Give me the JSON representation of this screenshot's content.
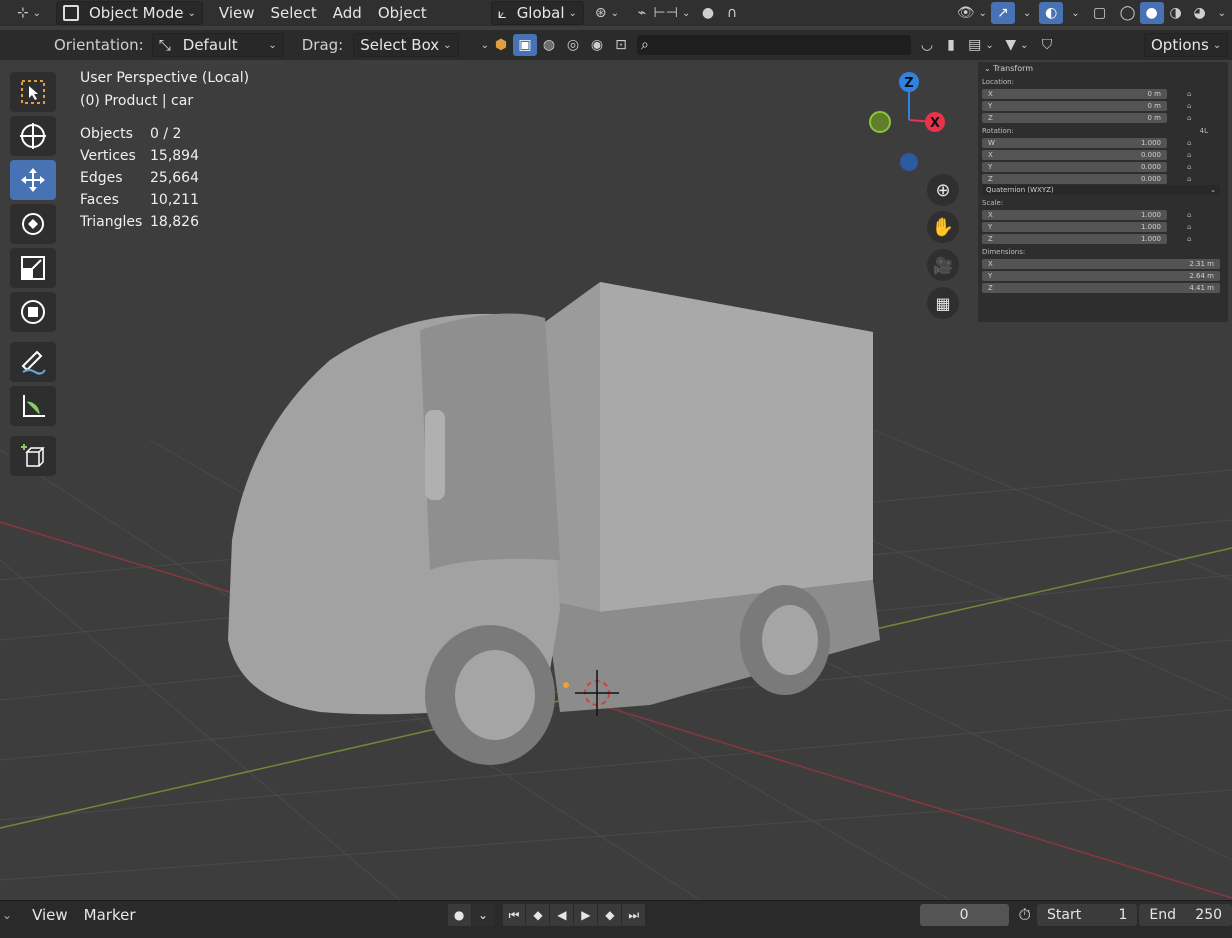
{
  "header": {
    "mode": "Object Mode",
    "menus": [
      "View",
      "Select",
      "Add",
      "Object"
    ],
    "transform_orientation": "Global"
  },
  "tool_header": {
    "orientation_label": "Orientation:",
    "orientation_value": "Default",
    "drag_label": "Drag:",
    "drag_value": "Select Box",
    "options_label": "Options"
  },
  "overlay": {
    "view_name": "User Perspective (Local)",
    "collection_object": "(0) Product | car",
    "stats": [
      {
        "label": "Objects",
        "value": "0 / 2"
      },
      {
        "label": "Vertices",
        "value": "15,894"
      },
      {
        "label": "Edges",
        "value": "25,664"
      },
      {
        "label": "Faces",
        "value": "10,211"
      },
      {
        "label": "Triangles",
        "value": "18,826"
      }
    ]
  },
  "gizmo": {
    "z": "Z",
    "x": "X"
  },
  "transform_panel": {
    "title": "Transform",
    "location_label": "Location:",
    "location": [
      {
        "axis": "X",
        "value": "0 m"
      },
      {
        "axis": "Y",
        "value": "0 m"
      },
      {
        "axis": "Z",
        "value": "0 m"
      }
    ],
    "rotation_label": "Rotation:",
    "rotation_lock": "4L",
    "rotation": [
      {
        "axis": "W",
        "value": "1.000"
      },
      {
        "axis": "X",
        "value": "0.000"
      },
      {
        "axis": "Y",
        "value": "0.000"
      },
      {
        "axis": "Z",
        "value": "0.000"
      }
    ],
    "rotation_mode": "Quaternion (WXYZ)",
    "scale_label": "Scale:",
    "scale": [
      {
        "axis": "X",
        "value": "1.000"
      },
      {
        "axis": "Y",
        "value": "1.000"
      },
      {
        "axis": "Z",
        "value": "1.000"
      }
    ],
    "dimensions_label": "Dimensions:",
    "dimensions": [
      {
        "axis": "X",
        "value": "2.31 m"
      },
      {
        "axis": "Y",
        "value": "2.64 m"
      },
      {
        "axis": "Z",
        "value": "4.41 m"
      }
    ]
  },
  "timeline": {
    "menus": [
      "View",
      "Marker"
    ],
    "current_frame": "0",
    "start_label": "Start",
    "start_value": "1",
    "end_label": "End",
    "end_value": "250"
  },
  "colors": {
    "accent": "#4772b3",
    "x_axis": "#e8334a",
    "y_axis": "#8ac33f",
    "z_axis": "#2f83e3"
  }
}
